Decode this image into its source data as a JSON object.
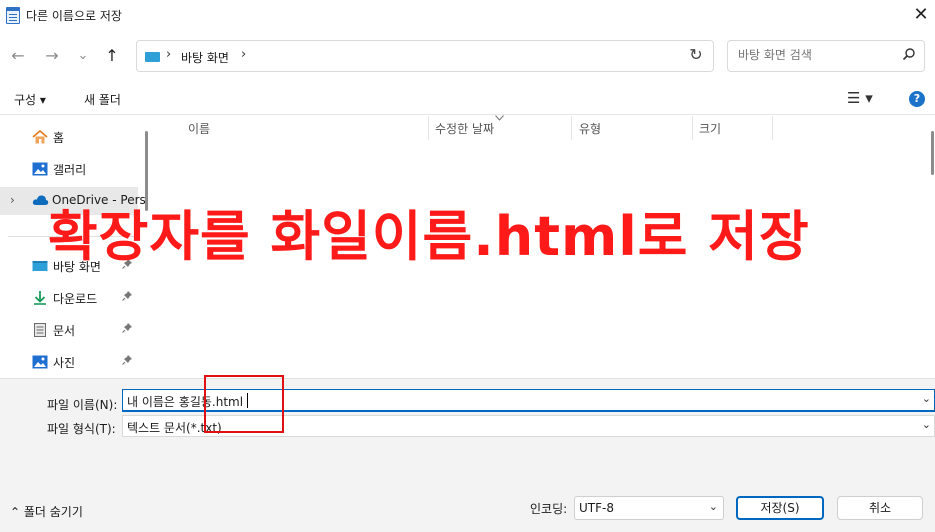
{
  "window": {
    "title": "다른 이름으로 저장",
    "close_glyph": "✕"
  },
  "nav": {
    "back_glyph": "←",
    "forward_glyph": "→",
    "recent_glyph": "⌄",
    "up_glyph": "↑",
    "address": {
      "sep": "›",
      "location": "바탕 화면"
    },
    "refresh_glyph": "↻",
    "search_placeholder": "바탕 화면 검색"
  },
  "toolbar": {
    "organize_label": "구성 ▾",
    "new_folder_label": "새 폴더",
    "view_glyph": "☰ ▾",
    "help_glyph": "?"
  },
  "sidebar": {
    "items": [
      {
        "label": "홈"
      },
      {
        "label": "갤러리"
      },
      {
        "label": "OneDrive - Pers"
      },
      {
        "label": "바탕 화면"
      },
      {
        "label": "다운로드"
      },
      {
        "label": "문서"
      },
      {
        "label": "사진"
      }
    ],
    "expand_glyph": "›",
    "pin_glyph": "📌"
  },
  "file_list": {
    "columns": [
      "이름",
      "수정한 날짜",
      "유형",
      "크기"
    ]
  },
  "annotation": {
    "banner_text": "확장자를 화일이름.html로 저장"
  },
  "form": {
    "filename_label": "파일 이름(N):",
    "filename_value": "내 이름은 홍길동.html",
    "filetype_label": "파일 형식(T):",
    "filetype_value": "텍스트 문서(*.txt)",
    "dropdown_glyph": "⌄",
    "hide_folders_label": "⌃  폴더 숨기기",
    "encoding_label": "인코딩:",
    "encoding_value": "UTF-8",
    "save_label": "저장(S)",
    "cancel_label": "취소"
  },
  "colors": {
    "accent": "#0067c0",
    "annotation_red": "#ff1a1a"
  }
}
